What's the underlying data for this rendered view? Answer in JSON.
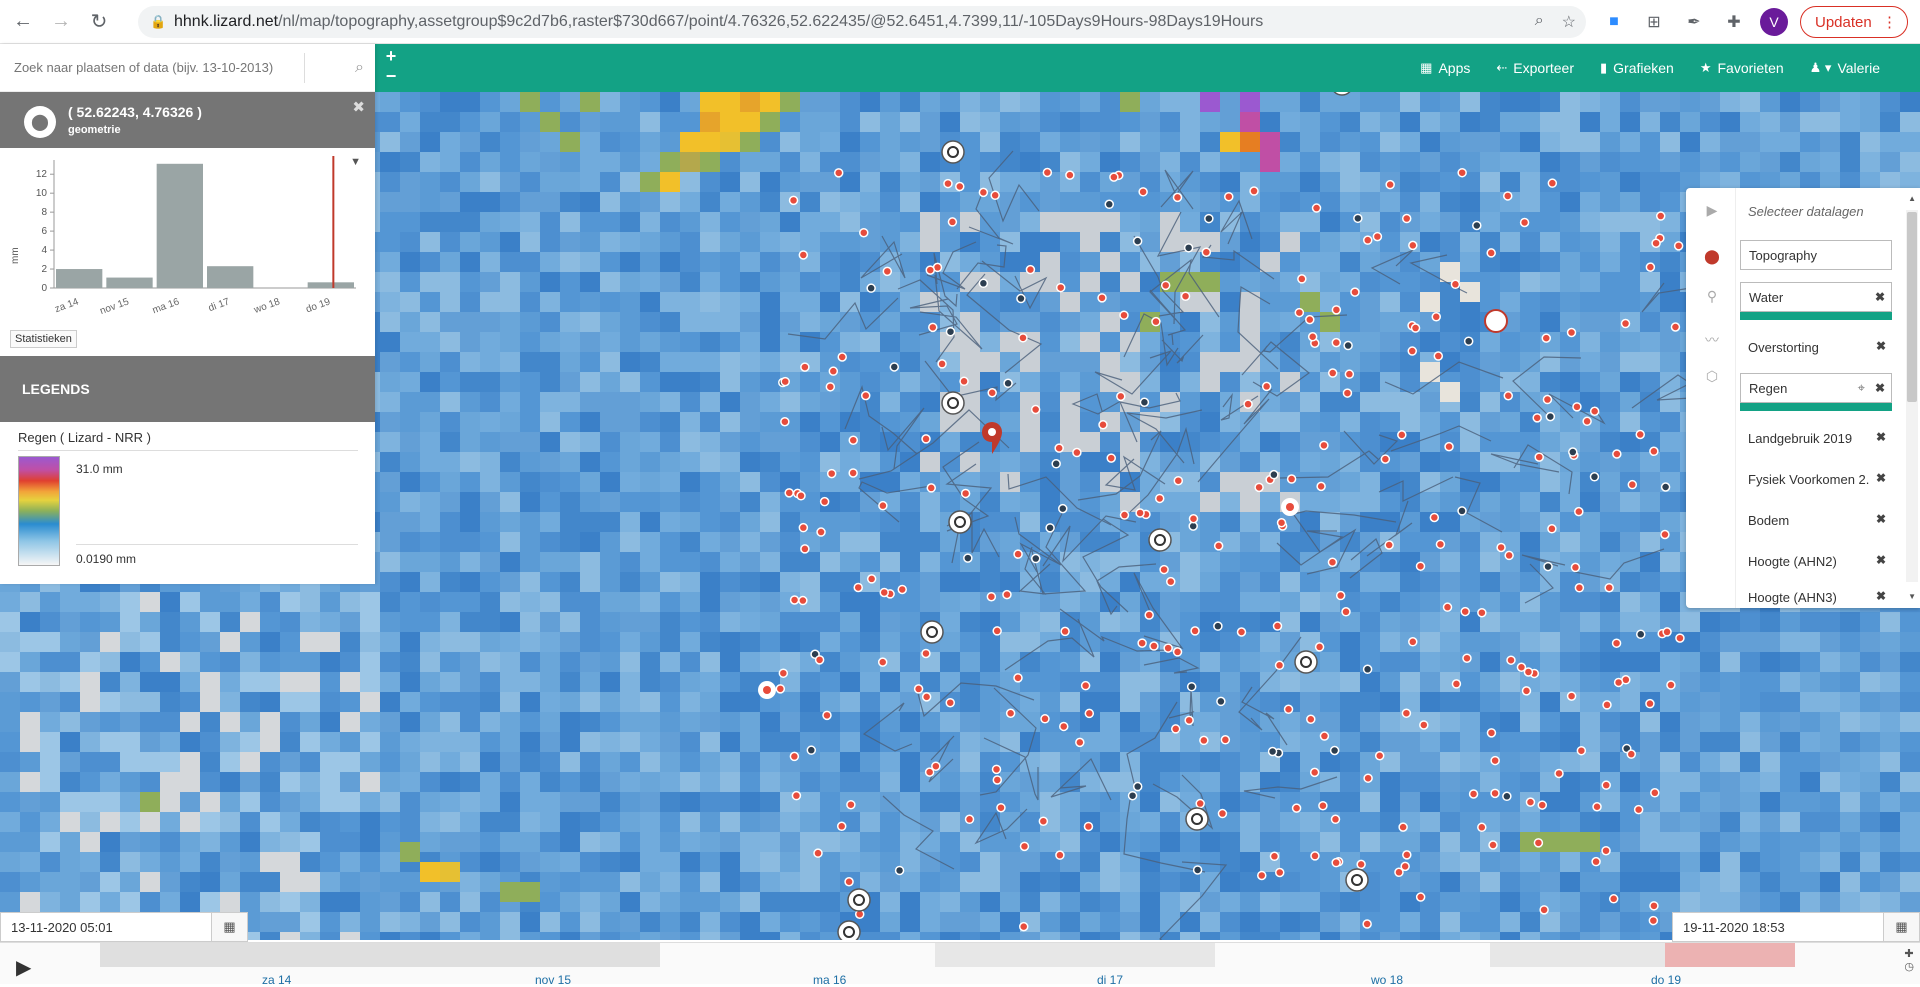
{
  "browser": {
    "url_host": "hhnk.lizard.net",
    "url_path": "/nl/map/topography,assetgroup$9c2d7b6,raster$730d667/point/4.76326,52.622435/@52.6451,4.7399,11/-105Days9Hours-98Days19Hours",
    "avatar_letter": "V",
    "update_label": "Updaten"
  },
  "toolbar": {
    "zoom_in": "+",
    "zoom_out": "−",
    "items": [
      {
        "icon": "apps-grid-icon",
        "label": "Apps"
      },
      {
        "icon": "export-icon",
        "label": "Exporteer"
      },
      {
        "icon": "chart-icon",
        "label": "Grafieken"
      },
      {
        "icon": "star-icon",
        "label": "Favorieten"
      },
      {
        "icon": "user-icon",
        "label": "Valerie"
      }
    ]
  },
  "search": {
    "placeholder": "Zoek naar plaatsen of data (bijv. 13-10-2013)"
  },
  "point": {
    "coords": "( 52.62243, 4.76326 )",
    "subtitle": "geometrie"
  },
  "chart_data": {
    "type": "bar",
    "categories": [
      "za 14",
      "nov 15",
      "ma 16",
      "di 17",
      "wo 18",
      "do 19"
    ],
    "values": [
      2.0,
      1.1,
      13.1,
      2.3,
      0,
      0.6
    ],
    "ylabel": "mm",
    "yticks": [
      0,
      2,
      4,
      6,
      8,
      10,
      12
    ],
    "ylim": [
      0,
      13.5
    ],
    "marker_category_index": 5,
    "bar_color": "#9aa5a5",
    "marker_color": "#c0392b"
  },
  "stats_label": "Statistieken",
  "legends": {
    "header": "LEGENDS",
    "title": "Regen ( Lizard - NRR )",
    "max": "31.0 mm",
    "min": "0.0190 mm"
  },
  "layers": {
    "title": "Selecteer datalagen",
    "items": [
      {
        "label": "Topography",
        "boxed": true,
        "remove": false,
        "active_bar": false
      },
      {
        "label": "Water",
        "boxed": true,
        "remove": true,
        "active_bar": true
      },
      {
        "label": "Overstorting",
        "boxed": false,
        "remove": true,
        "active_bar": false
      },
      {
        "label": "Regen",
        "boxed": true,
        "remove": true,
        "active_bar": true,
        "target": true
      },
      {
        "label": "Landgebruik 2019",
        "boxed": false,
        "remove": true,
        "active_bar": false
      },
      {
        "label": "Fysiek Voorkomen 2.",
        "boxed": false,
        "remove": true,
        "active_bar": false
      },
      {
        "label": "Bodem",
        "boxed": false,
        "remove": true,
        "active_bar": false
      },
      {
        "label": "Hoogte (AHN2)",
        "boxed": false,
        "remove": true,
        "active_bar": false
      },
      {
        "label": "Hoogte (AHN3)",
        "boxed": false,
        "remove": true,
        "active_bar": false
      }
    ]
  },
  "timeline": {
    "start": "13-11-2020 05:01",
    "end": "19-11-2020 18:53",
    "labels": [
      "za 14",
      "nov 15",
      "ma 16",
      "di 17",
      "wo 18",
      "do 19"
    ]
  },
  "colors": {
    "brand": "#13a285",
    "panel_grey": "#757575",
    "accent_red": "#c0392b"
  }
}
